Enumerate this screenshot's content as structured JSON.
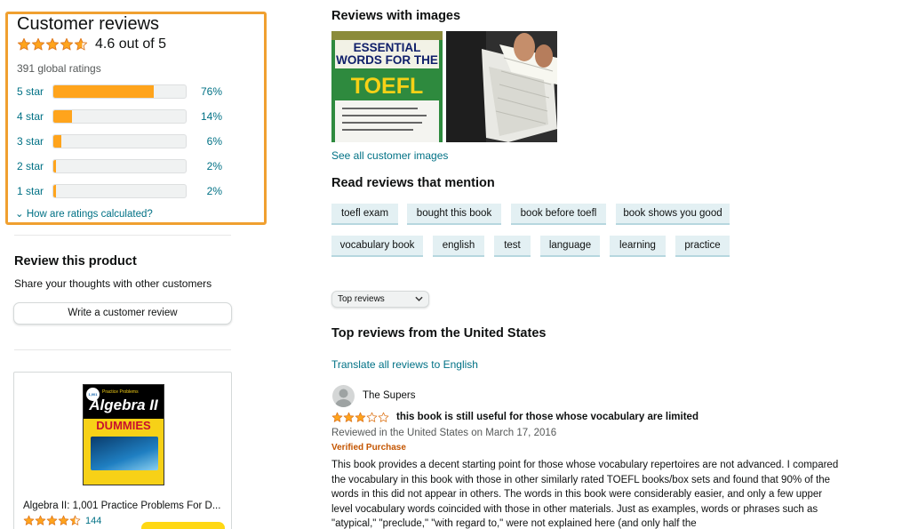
{
  "summary": {
    "title": "Customer reviews",
    "rating_value": 4.6,
    "rating_text": "4.6 out of 5",
    "global_ratings": "391 global ratings",
    "histogram": [
      {
        "label": "5 star",
        "pct_text": "76%",
        "pct": 76
      },
      {
        "label": "4 star",
        "pct_text": "14%",
        "pct": 14
      },
      {
        "label": "3 star",
        "pct_text": "6%",
        "pct": 6
      },
      {
        "label": "2 star",
        "pct_text": "2%",
        "pct": 2
      },
      {
        "label": "1 star",
        "pct_text": "2%",
        "pct": 2
      }
    ],
    "how_calculated": "How are ratings calculated?"
  },
  "review_product": {
    "title": "Review this product",
    "subtitle": "Share your thoughts with other customers",
    "button": "Write a customer review"
  },
  "ad": {
    "cover_badge": "1,001",
    "cover_series": "Practice Problems",
    "cover_title": "Algebra II",
    "cover_brand": "DUMMIES",
    "title": "Algebra II: 1,001 Practice Problems For D...",
    "rating_value": 4.5,
    "rating_count": "144"
  },
  "images_section": {
    "title": "Reviews with images",
    "image1_words": "ESSENTIAL WORDS FOR THE",
    "image1_brand": "TOEFL",
    "see_all": "See all customer images"
  },
  "mentions": {
    "title": "Read reviews that mention",
    "chips": [
      "toefl exam",
      "bought this book",
      "book before toefl",
      "book shows you good",
      "vocabulary book",
      "english",
      "test",
      "language",
      "learning",
      "practice"
    ]
  },
  "sort": {
    "selected": "Top reviews"
  },
  "top_reviews": {
    "title": "Top reviews from the United States",
    "translate": "Translate all reviews to English"
  },
  "review": {
    "reviewer": "The Supers",
    "rating_value": 3,
    "title": "this book is still useful for those whose vocabulary are limited",
    "date": "Reviewed in the United States on March 17, 2016",
    "verified": "Verified Purchase",
    "body": "This book provides a decent starting point for those whose vocabulary repertoires are not advanced. I compared the vocabulary in this book with those in other similarly rated TOEFL books/box sets and found that 90% of the words in this did not appear in others. The words in this book were considerably easier, and only a few upper level vocabulary words coincided with those in other materials. Just as examples, words or phrases such as \"atypical,\" \"preclude,\" \"with regard to,\" were not explained here (and only half the"
  },
  "colors": {
    "star": "#ffa41c",
    "link": "#007185",
    "highlight_border": "#f0a030",
    "chip_bg": "#e3f0f3",
    "verified": "#c45500"
  }
}
